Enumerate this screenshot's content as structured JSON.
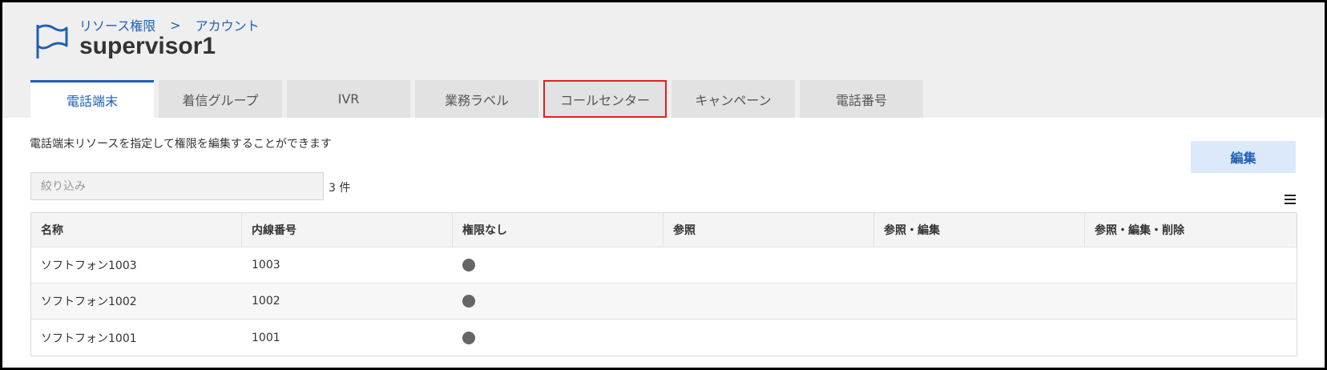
{
  "breadcrumb": {
    "parent": "リソース権限",
    "separator": ">",
    "current": "アカウント"
  },
  "page": {
    "title": "supervisor1"
  },
  "tabs": [
    {
      "label": "電話端末",
      "active": true
    },
    {
      "label": "着信グループ"
    },
    {
      "label": "IVR"
    },
    {
      "label": "業務ラベル"
    },
    {
      "label": "コールセンター",
      "highlighted": true
    },
    {
      "label": "キャンペーン"
    },
    {
      "label": "電話番号"
    }
  ],
  "description": "電話端末リソースを指定して権限を編集することができます",
  "toolbar": {
    "edit_label": "編集"
  },
  "filter": {
    "placeholder": "絞り込み",
    "value": ""
  },
  "result_count": "3 件",
  "table": {
    "columns": [
      "名称",
      "内線番号",
      "権限なし",
      "参照",
      "参照・編集",
      "参照・編集・削除"
    ],
    "rows": [
      {
        "name": "ソフトフォン1003",
        "extension": "1003",
        "permission": "権限なし"
      },
      {
        "name": "ソフトフォン1002",
        "extension": "1002",
        "permission": "権限なし"
      },
      {
        "name": "ソフトフォン1001",
        "extension": "1001",
        "permission": "権限なし"
      }
    ]
  },
  "colors": {
    "accent": "#1f5fb4",
    "highlight_border": "#e02020",
    "radio_selected": "#666666"
  },
  "icons": {
    "header": "flag-icon",
    "table_menu": "hamburger-menu-icon"
  }
}
